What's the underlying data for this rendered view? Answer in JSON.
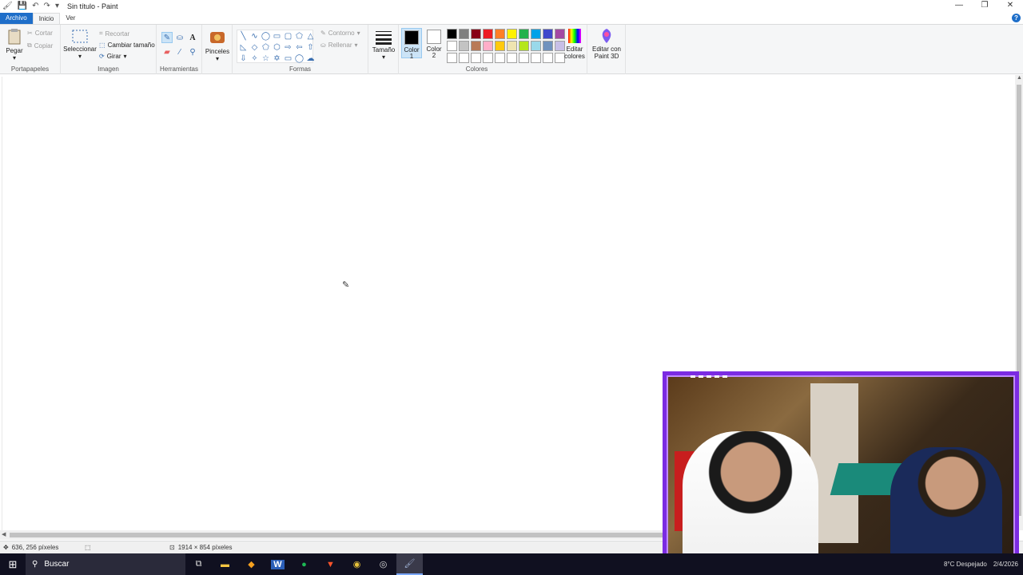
{
  "window": {
    "title": "Sin título - Paint",
    "controls": [
      "minimize",
      "restore",
      "close"
    ]
  },
  "tabs": {
    "file": "Archivo",
    "home": "Inicio",
    "view": "Ver"
  },
  "ribbon": {
    "clipboard": {
      "label": "Portapapeles",
      "paste": "Pegar",
      "cut": "Cortar",
      "copy": "Copiar"
    },
    "image": {
      "label": "Imagen",
      "select": "Seleccionar",
      "crop": "Recortar",
      "resize": "Cambiar tamaño",
      "rotate": "Girar"
    },
    "tools": {
      "label": "Herramientas"
    },
    "brushes": {
      "label": "Pinceles"
    },
    "shapes": {
      "label": "Formas",
      "outline": "Contorno",
      "fill": "Rellenar"
    },
    "size": {
      "label": "Tamaño"
    },
    "colors": {
      "label": "Colores",
      "color1_label": "Color",
      "color1_num": "1",
      "color2_label": "Color",
      "color2_num": "2",
      "color1": "#000000",
      "color2": "#ffffff",
      "edit_line1": "Editar",
      "edit_line2": "colores",
      "paint3d_line1": "Editar con",
      "paint3d_line2": "Paint 3D",
      "palette": [
        "#000000",
        "#7f7f7f",
        "#880015",
        "#ed1c24",
        "#ff7f27",
        "#fff200",
        "#22b14c",
        "#00a2e8",
        "#3f48cc",
        "#a349a4",
        "#ffffff",
        "#c3c3c3",
        "#b97a57",
        "#ffaec9",
        "#ffc90e",
        "#efe4b0",
        "#b5e61d",
        "#99d9ea",
        "#7092be",
        "#c8bfe7",
        "#ffffff",
        "#ffffff",
        "#ffffff",
        "#ffffff",
        "#ffffff",
        "#ffffff",
        "#ffffff",
        "#ffffff",
        "#ffffff",
        "#ffffff"
      ]
    }
  },
  "status": {
    "cursor_position": "636, 256 píxeles",
    "image_size": "1914 × 854 píxeles"
  },
  "taskbar": {
    "search_placeholder": "Buscar",
    "weather": "8°C  Despejado",
    "date": "2/4/2026"
  }
}
